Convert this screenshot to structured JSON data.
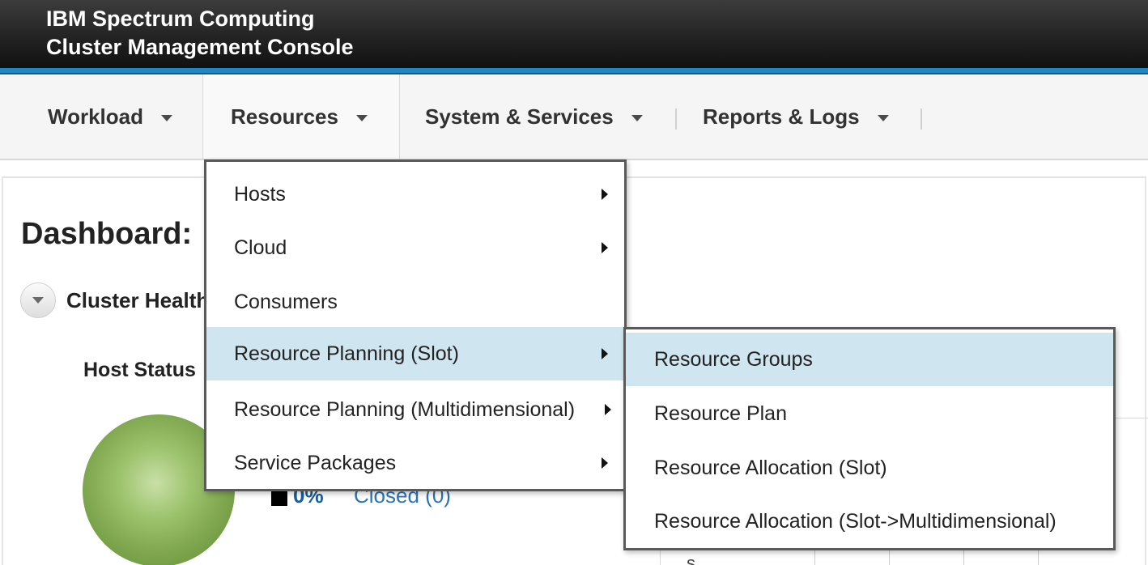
{
  "app": {
    "title_line1": "IBM Spectrum Computing",
    "title_line2": "Cluster Management Console"
  },
  "nav": {
    "items": [
      {
        "label": "Workload",
        "icon": "chevron-down-icon"
      },
      {
        "label": "Resources",
        "icon": "chevron-down-icon"
      },
      {
        "label": "System & Services",
        "icon": "chevron-down-icon"
      },
      {
        "label": "Reports & Logs",
        "icon": "chevron-down-icon"
      }
    ],
    "active": "Resources"
  },
  "page": {
    "title": "Dashboard:",
    "section_title": "Cluster Health",
    "sub_title": "Host Status",
    "legend": {
      "percent": "0%",
      "link": "Closed (0)"
    },
    "background_fragment": "s"
  },
  "resources_menu": {
    "items": [
      {
        "label": "Hosts",
        "has_submenu": true
      },
      {
        "label": "Cloud",
        "has_submenu": true
      },
      {
        "label": "Consumers",
        "has_submenu": false
      },
      {
        "label": "Resource Planning (Slot)",
        "has_submenu": true,
        "highlighted": true
      },
      {
        "label": "Resource Planning (Multidimensional)",
        "has_submenu": true
      },
      {
        "label": "Service Packages",
        "has_submenu": true
      }
    ]
  },
  "resource_planning_submenu": {
    "items": [
      {
        "label": "Resource Groups",
        "highlighted": true
      },
      {
        "label": "Resource Plan"
      },
      {
        "label": "Resource Allocation (Slot)"
      },
      {
        "label": "Resource Allocation (Slot->Multidimensional)"
      }
    ]
  },
  "colors": {
    "accent": "#1f86c7",
    "highlight": "#cfe5f0",
    "header_bg": "#232323",
    "status_ok": "#7ea64e",
    "link": "#2a75b8"
  }
}
